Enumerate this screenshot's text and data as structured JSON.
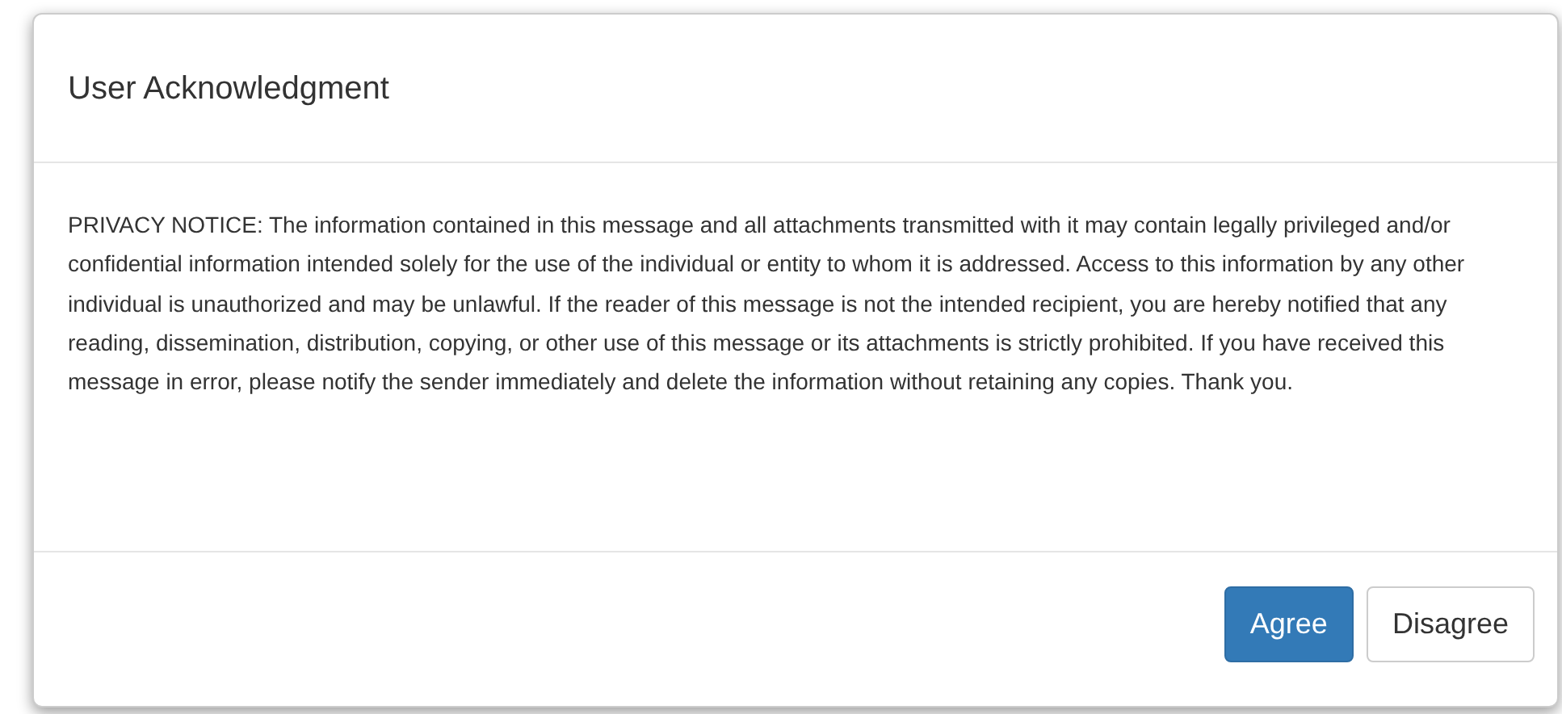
{
  "dialog": {
    "title": "User Acknowledgment",
    "body": "PRIVACY NOTICE: The information contained in this message and all attachments transmitted with it may contain legally privileged and/or confidential information intended solely for the use of the individual or entity to whom it is addressed. Access to this information by any other individual is unauthorized and may be unlawful. If the reader of this message is not the intended recipient, you are hereby notified that any reading, dissemination, distribution, copying, or other use of this message or its attachments is strictly prohibited. If you have received this message in error, please notify the sender immediately and delete the information without retaining any copies. Thank you.",
    "buttons": [
      {
        "label": "Agree",
        "kind": "primary"
      },
      {
        "label": "Disagree",
        "kind": "default"
      }
    ]
  }
}
